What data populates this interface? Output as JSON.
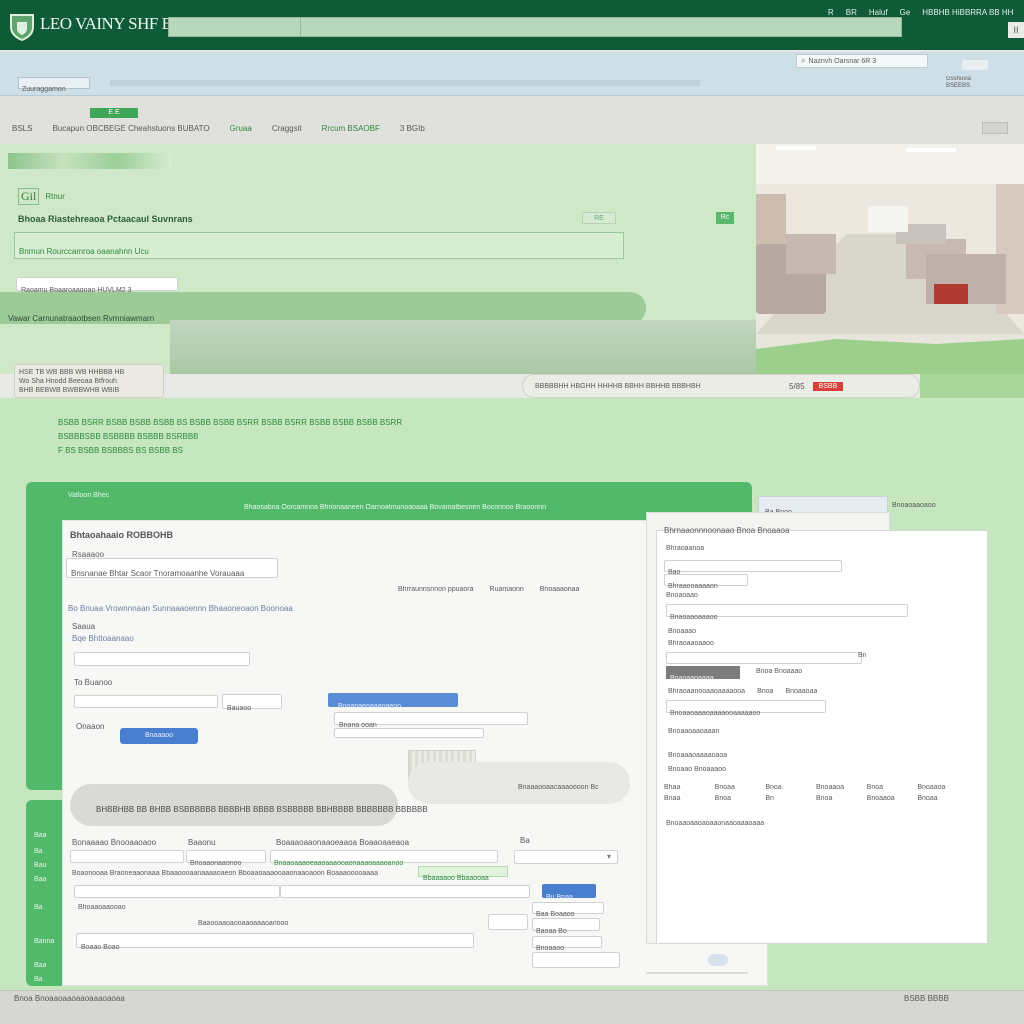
{
  "header": {
    "logo_text": "LEO VAINY SHF BXEL",
    "logo_sub": "",
    "top_links": [
      "R",
      "BR",
      "Haluf",
      "Ge",
      "HBBHB HiBBRRA BB HH"
    ],
    "right_badge": "II"
  },
  "toolbar": {
    "search_value": "Nazrivh Oarsnar 6R 3",
    "chip_label": "",
    "nav_left": "Zuuraggamon",
    "nav_right_label": "Gsshuvia BSEEBS"
  },
  "subnav": {
    "tag": "E E",
    "items": [
      "BSLS",
      "Bucapun OBCBEGE Cheahstuons BUBATO",
      "Gruaa",
      "Craggsit",
      "Rrcum BSAOBF",
      "3 BGIb"
    ]
  },
  "hero": {
    "brand": "Gil",
    "brand_sub": "Rtnur",
    "headline": "Bhoaa Riastehreaoa Pctaacaul Suvnrans",
    "tag": "RE",
    "tag_right": "Rc",
    "hint": "Bnmun Rourccamroa oaanahnn Ucu",
    "input_value": "Raoamu Boaaroaagoao HUVLM2 3",
    "banner_text": "Vawar Carnunatraaotbsen Rvmniawmarn",
    "note_lines": [
      "HSE TB WB BBB WB HHBBB HB",
      "Wo Sha Hnodd Beeoaa Btfrouh",
      "BHB BEBWB BWBBWHB WBIB"
    ],
    "pill_text": "BBBBBHH HBGHH HHHHB BBHH BBHHB BBBHBH",
    "pill_num": "5/85",
    "pill_badge": "BSBB"
  },
  "info": {
    "lines": [
      "BSBB BSRR BSBB BSBB BSBB BS BSBB BSBB BSRR BSBB BSRR BSBB BSBB BSBB BSRR",
      "BSBBBSBB BSBBBB BSBBB BSRBBB",
      "F BS BSBB BSBBBS BS BSBB BS"
    ]
  },
  "form": {
    "header_label": "Vatloon Bhec",
    "header_title": "Bhaosabna Oorcamnoa Bhrionaaneen Oarnoatmunoaoaaa Bovamatbesnen Boconnoo Braoonnn",
    "section_title": "Bhtaoahaaio ROBBOHB",
    "field1_label": "Rsaaaoo",
    "field1_value": "Bnsnanae Bhtar Scaor Tnoramoaanhe Vorauaaa",
    "center_links": [
      "Bhrraunnsnnon ppuaora",
      "Ruamaonn",
      "Bnoaaaonaa"
    ],
    "row_text": "Bo Bnuaa Vrownnnaan Sunnaaaoennn Bhaaoneoaon Boonoaa",
    "field2_label": "Saaua",
    "field2_sub": "Bqe Bhttoaanaao",
    "field3_label": "To Buanoo",
    "field3_value": "Bauaoo",
    "blue_select": "Bnoanaeoaaaoaeoo",
    "mid_input": "Bnana ooan",
    "field4_label": "Onaaon",
    "primary_button": "Bnaaaoo",
    "thumb_caption": "Bnaaaooaacaaaoooon Bc",
    "pill_banner": "BHBBHBB BB BHBB BSBBBBBB BBBBHB BBBB BSBBBBB BBHBBBB BBBBBBB BBBBBB",
    "section2_title": "Bonaaaao Bnooaaoaoo",
    "s2_label2": "Baaonu",
    "s2_link": "Boaaaoaaonaaoeaaoa Boaaoaaeaoa",
    "s2_side": "Ba",
    "s2_input1": "Bnoaaonaaonoo",
    "s2_input2": "Bnaaoaaaoeaaoaaaooaonaaaoaaaoanoo",
    "s2_long": "Boaonooaa Braoneaaonaaa Bbaaoooaanaaaaoaeon Bboaaoaaaooaaonaaoaoon Boaaaooooaaaa",
    "s2_green": "Bbaaaaoo Bbaaooaa",
    "s2_blue": "Bu Bnaa",
    "s2_sub": "Bhoaaoaaooao",
    "s2_field": "Baaooaaoaooaaoaaaoanooo",
    "s2_right1": "Baa Boaaoo",
    "s2_right2": "Baoaa Bo",
    "s2_right3": "Bnoaaoo",
    "s2_input3": "Boaao Boao",
    "sidebar_items": [
      "Baa",
      "Ba",
      "Bau",
      "Baa",
      "Ba",
      "Banna",
      "Baa",
      "Ba"
    ]
  },
  "card": {
    "tab_label": "Ba Bnoo",
    "tab_right": "Bnoaoaaoaoo",
    "title": "Bhrnaaonnnoonaao Bnoa Bnoaaoa",
    "lines": [
      "Bhraoaanoa",
      "Bao",
      "Bhraaooaaaaon",
      "Bnoaoaao",
      "Bnoaaao",
      "Bhraoaaoaaoo",
      "Bnoaaoaaoaaan",
      "Bhraoaaonaa"
    ],
    "select_value": "Bnaoaaoaaaoo",
    "right_val": "Bn",
    "chip": "Bnaoaaoaaaa",
    "chip_note": "Bnoa Bnoaaao",
    "row_labels": [
      "Bhraoaanooaaoaaaaooa",
      "Bnoa",
      "Bnoaaoaa"
    ],
    "field_value": "Bnoaaoaaaoaaaaooaaaaaoo",
    "stack": [
      "Bnoaaaoaaaaoaoa",
      "Bnoaao Bnoaaaoo"
    ],
    "grid": [
      "Bhaa",
      "Bnoaa",
      "Bnoa",
      "Bnoaaoa",
      "Bnoa",
      "Bnoaaoa",
      "Bnaa",
      "Bnoa",
      "Bn",
      "Bnoa",
      "Bnoaaoa",
      "Bnoaa"
    ],
    "footer_line": "Bnoaaoaaoaoaaonaaoaaaoaaa"
  },
  "footer": {
    "left": "Bnoa Bnoaaoaaoaaoaaaoaoaa",
    "right": "BSBB BBBB"
  },
  "colors": {
    "header_green": "#0f5a37",
    "panel_green": "#d4ebcf",
    "accent_green": "#4cb866",
    "blue": "#4a7fd0",
    "gray_band": "#e0e1dc"
  },
  "icons": [
    "shield-logo-icon",
    "search-icon",
    "chevron-down-icon",
    "close-icon",
    "settings-icon"
  ]
}
